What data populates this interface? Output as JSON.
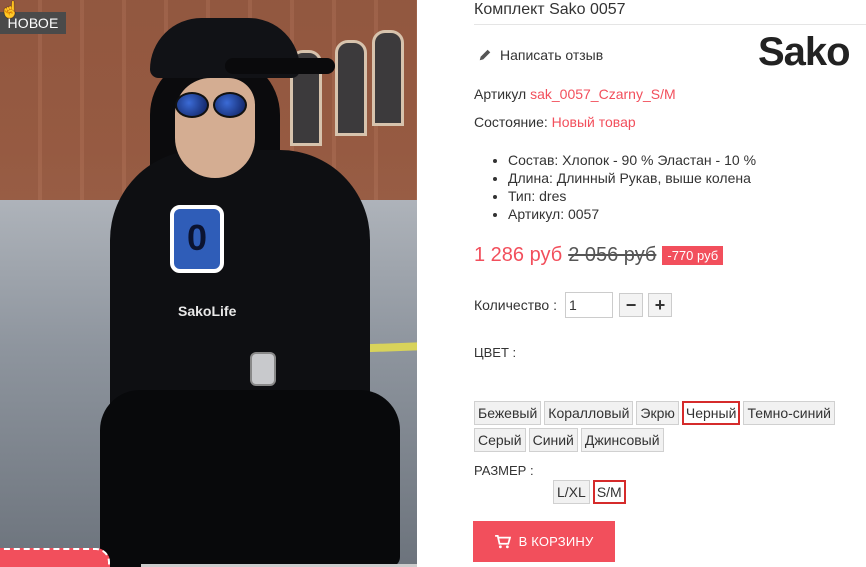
{
  "photo": {
    "badge": "НОВОЕ",
    "shirt_logo": "SakoLife",
    "shirt_number": "0"
  },
  "product": {
    "title": "Комплект Sako 0057",
    "review_link": "Написать отзыв",
    "brand_logo": "Sako",
    "sku_label": "Артикул",
    "sku_value": "sak_0057_Czarny_S/M",
    "condition_label": "Состояние:",
    "condition_value": "Новый товар",
    "features": [
      "Состав: Хлопок - 90 % Эластан - 10 %",
      "Длина: Длинный Рукав, выше колена",
      "Тип: dres",
      "Артикул: 0057"
    ],
    "price": "1 286 руб",
    "old_price": "2 056 руб",
    "discount": "-770 руб"
  },
  "quantity": {
    "label": "Количество :",
    "value": "1",
    "minus": "−",
    "plus": "+"
  },
  "color": {
    "label": "ЦВЕТ :",
    "options": [
      "Бежевый",
      "Коралловый",
      "Экрю",
      "Черный",
      "Темно-синий",
      "Серый",
      "Синий",
      "Джинсовый"
    ],
    "selected": "Черный"
  },
  "size": {
    "label": "РАЗМЕР :",
    "options": [
      "L/XL",
      "S/M"
    ],
    "selected": "S/M"
  },
  "cart": {
    "label": "В КОРЗИНУ"
  },
  "colors": {
    "accent": "#f24f5c",
    "selected_border": "#d52b2b",
    "badge_bg": "#4a4a4a"
  }
}
